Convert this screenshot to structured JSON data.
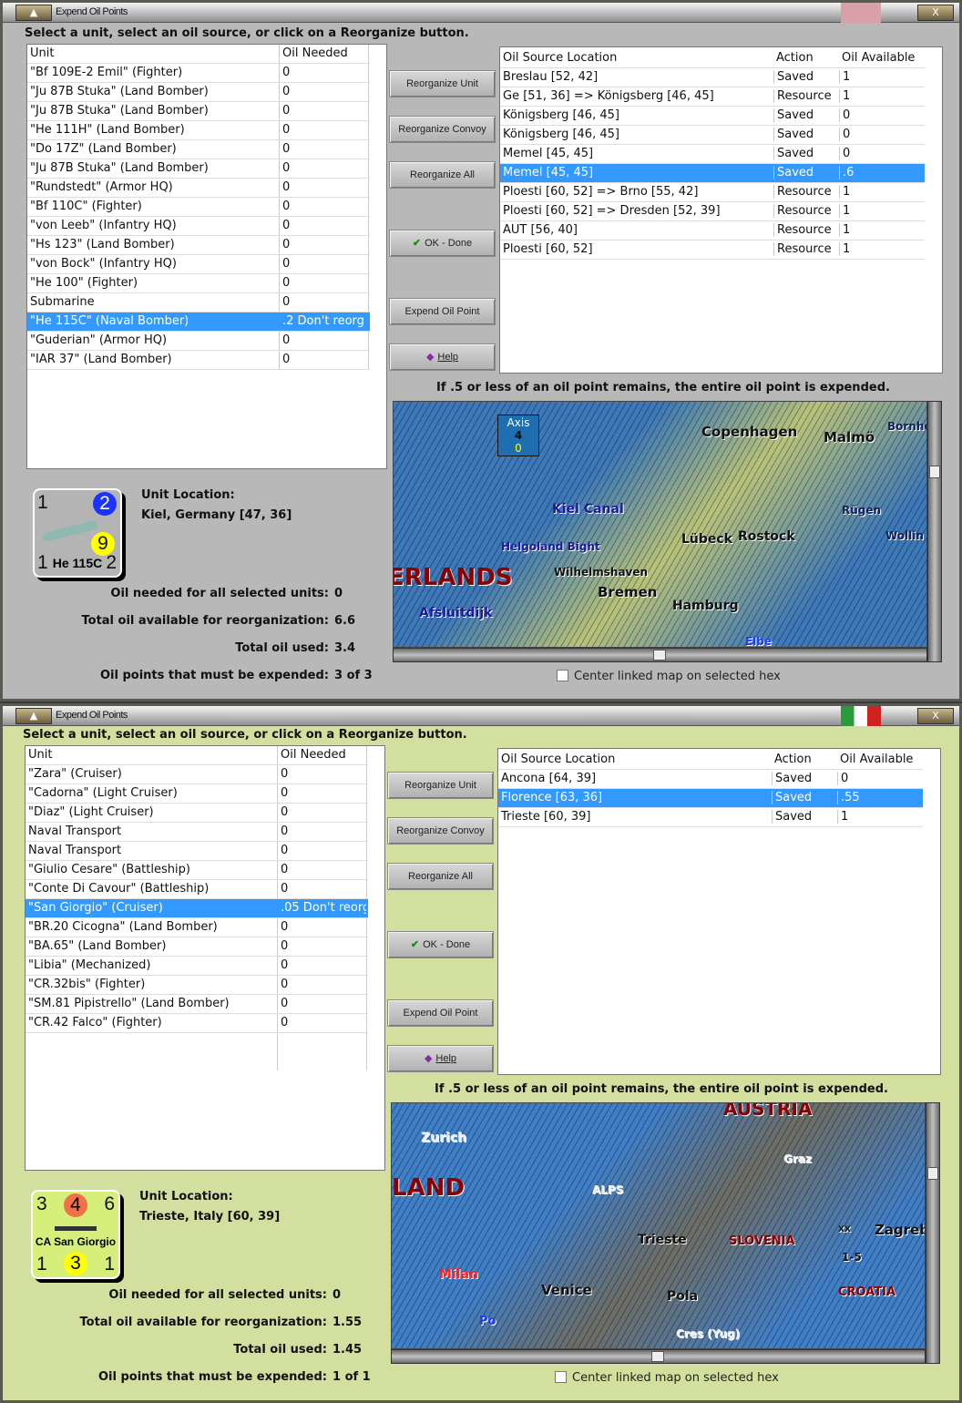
{
  "windows": [
    {
      "title": "Expend Oil Points",
      "flag": "german-war-flag",
      "bg": "#b8b8b8",
      "instruction": "Select a unit, select an oil source, or click on a Reorganize button.",
      "units": {
        "headers": [
          "Unit",
          "Oil Needed"
        ],
        "selected": 13,
        "rows": [
          [
            "\"Bf 109E-2 Emil\" (Fighter)",
            "0"
          ],
          [
            "\"Ju 87B Stuka\" (Land Bomber)",
            "0"
          ],
          [
            "\"Ju 87B Stuka\" (Land Bomber)",
            "0"
          ],
          [
            "\"He 111H\" (Land Bomber)",
            "0"
          ],
          [
            "\"Do 17Z\" (Land Bomber)",
            "0"
          ],
          [
            "\"Ju 87B Stuka\" (Land Bomber)",
            "0"
          ],
          [
            "\"Rundstedt\" (Armor HQ)",
            "0"
          ],
          [
            "\"Bf 110C\" (Fighter)",
            "0"
          ],
          [
            "\"von Leeb\" (Infantry HQ)",
            "0"
          ],
          [
            "\"Hs 123\" (Land Bomber)",
            "0"
          ],
          [
            "\"von Bock\" (Infantry HQ)",
            "0"
          ],
          [
            "\"He 100\" (Fighter)",
            "0"
          ],
          [
            "Submarine",
            "0"
          ],
          [
            "\"He 115C\" (Naval Bomber)",
            ".2 Don't reorg"
          ],
          [
            "\"Guderian\" (Armor HQ)",
            "0"
          ],
          [
            "\"IAR 37\" (Land Bomber)",
            "0"
          ]
        ]
      },
      "buttons": [
        "Reorganize Unit",
        "Reorganize Convoy",
        "Reorganize All",
        "OK - Done",
        "Expend Oil Point",
        "Help"
      ],
      "sources": {
        "headers": [
          "Oil Source Location",
          "Action",
          "Oil Available"
        ],
        "selected": 5,
        "rows": [
          [
            "Breslau [52, 42]",
            "Saved",
            "1"
          ],
          [
            "Ge [51, 36] => Königsberg [46, 45]",
            "Resource",
            "1"
          ],
          [
            "Königsberg [46, 45]",
            "Saved",
            "0"
          ],
          [
            "Königsberg [46, 45]",
            "Saved",
            "0"
          ],
          [
            "Memel [45, 45]",
            "Saved",
            "0"
          ],
          [
            "Memel [45, 45]",
            "Saved",
            ".6"
          ],
          [
            "Ploesti [60, 52] => Brno [55, 42]",
            "Resource",
            "1"
          ],
          [
            "Ploesti [60, 52] => Dresden [52, 39]",
            "Resource",
            "1"
          ],
          [
            "AUT [56, 40]",
            "Resource",
            "1"
          ],
          [
            "Ploesti [60, 52]",
            "Resource",
            "1"
          ]
        ]
      },
      "note": "If .5 or less of an oil point remains, the entire oil point is expended.",
      "map": {
        "labels": [
          "Copenhagen",
          "Malmö",
          "Bornholm",
          "Kiel Canal",
          "Rügen",
          "Lübeck",
          "Rostock",
          "Wollin",
          "Helgoland Bight",
          "ERLANDS",
          "Wilhelmshaven",
          "Bremen",
          "Hamburg",
          "Afsluitdijk",
          "Elbe",
          "Axis",
          "4",
          "0"
        ],
        "sea": "#3d78b8",
        "land": "#b9c27a"
      },
      "checkbox": "Center linked map on selected hex",
      "counter": {
        "tl": "1",
        "tr": "2",
        "mid": "9",
        "bl": "1",
        "name": "He 115C",
        "br": "2",
        "face": "#b4b4b4",
        "tr_color": "#1a33ff",
        "mid_color": "#ffff00"
      },
      "location_label": "Unit Location:",
      "location": "Kiel, Germany [47, 36]",
      "stats": [
        [
          "Oil needed for all selected units:",
          "0"
        ],
        [
          "Total oil available for reorganization:",
          "6.6"
        ],
        [
          "Total oil used:",
          "3.4"
        ],
        [
          "Oil points that must be expended:",
          "3 of 3"
        ]
      ]
    },
    {
      "title": "Expend Oil Points",
      "flag": "italian-flag",
      "bg": "#d3df9e",
      "instruction": "Select a unit, select an oil source, or click on a Reorganize button.",
      "units": {
        "headers": [
          "Unit",
          "Oil Needed"
        ],
        "selected": 7,
        "rows": [
          [
            "\"Zara\" (Cruiser)",
            "0"
          ],
          [
            "\"Cadorna\" (Light Cruiser)",
            "0"
          ],
          [
            "\"Diaz\" (Light Cruiser)",
            "0"
          ],
          [
            "Naval Transport",
            "0"
          ],
          [
            "Naval Transport",
            "0"
          ],
          [
            "\"Giulio Cesare\" (Battleship)",
            "0"
          ],
          [
            "\"Conte Di Cavour\" (Battleship)",
            "0"
          ],
          [
            "\"San Giorgio\" (Cruiser)",
            ".05 Don't reorg"
          ],
          [
            "\"BR.20 Cicogna\" (Land Bomber)",
            "0"
          ],
          [
            "\"BA.65\" (Land Bomber)",
            "0"
          ],
          [
            "\"Libia\" (Mechanized)",
            "0"
          ],
          [
            "\"CR.32bis\" (Fighter)",
            "0"
          ],
          [
            "\"SM.81 Pipistrello\" (Land Bomber)",
            "0"
          ],
          [
            "\"CR.42 Falco\" (Fighter)",
            "0"
          ]
        ]
      },
      "buttons": [
        "Reorganize Unit",
        "Reorganize Convoy",
        "Reorganize All",
        "OK - Done",
        "Expend Oil Point",
        "Help"
      ],
      "sources": {
        "headers": [
          "Oil Source Location",
          "Action",
          "Oil Available"
        ],
        "selected": 1,
        "rows": [
          [
            "Ancona [64, 39]",
            "Saved",
            "0"
          ],
          [
            "Florence [63, 36]",
            "Saved",
            ".55"
          ],
          [
            "Trieste [60, 39]",
            "Saved",
            "1"
          ]
        ]
      },
      "note": "If .5 or less of an oil point remains, the entire oil point is expended.",
      "map": {
        "labels": [
          "AUSTRIA",
          "Zurich",
          "Graz",
          "LAND",
          "ALPS",
          "SLOVENIA",
          "Zagreb",
          "Milan",
          "Venice",
          "Pola",
          "CROATIA",
          "Po",
          "Cres (Yug)",
          "Trieste",
          "XX",
          "1-5"
        ],
        "sea": "#3f7fc8",
        "land": "#6d6d66"
      },
      "checkbox": "Center linked map on selected hex",
      "counter": {
        "tl": "3",
        "tr": "6",
        "mid": "4",
        "bl": "1",
        "name": "CA San Giorgio",
        "br": "1",
        "bm": "3",
        "face": "#d6ee7a",
        "mid_color": "#f0704a",
        "bm_color": "#ffff00"
      },
      "location_label": "Unit Location:",
      "location": "Trieste, Italy [60, 39]",
      "stats": [
        [
          "Oil needed for all selected units:",
          "0"
        ],
        [
          "Total oil available for reorganization:",
          "1.55"
        ],
        [
          "Total oil used:",
          "1.45"
        ],
        [
          "Oil points that must be expended:",
          "1 of 1"
        ]
      ]
    }
  ]
}
